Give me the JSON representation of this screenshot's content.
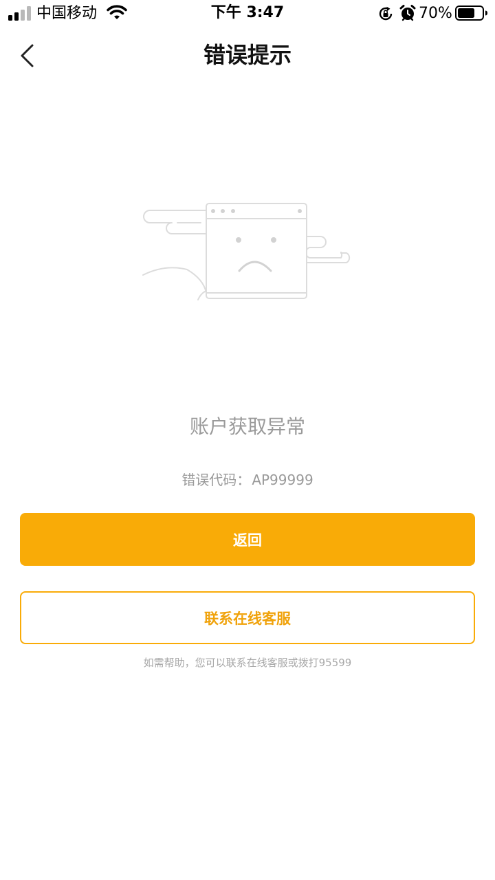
{
  "status_bar": {
    "carrier": "中国移动",
    "time": "下午 3:47",
    "battery_percent": "70%",
    "battery_level": 0.7,
    "signal_bars_filled": 2,
    "signal_bars_total": 4,
    "icons": [
      "signal-icon",
      "wifi-icon",
      "rotation-lock-icon",
      "alarm-icon",
      "battery-icon"
    ]
  },
  "nav": {
    "title": "错误提示",
    "back_icon": "chevron-left-icon"
  },
  "illustration": {
    "icon": "sad-browser-window-icon"
  },
  "error": {
    "message": "账户获取异常",
    "code_label": "错误代码",
    "code_separator": "：",
    "code_value": "AP99999"
  },
  "actions": {
    "back_label": "返回",
    "contact_label": "联系在线客服"
  },
  "help": {
    "text": "如需帮助，您可以联系在线客服或拨打95599"
  },
  "colors": {
    "accent": "#f9ab07",
    "muted_text": "#9a9a9a",
    "title_text": "#111111",
    "illustration_stroke": "#dcdcdc"
  }
}
